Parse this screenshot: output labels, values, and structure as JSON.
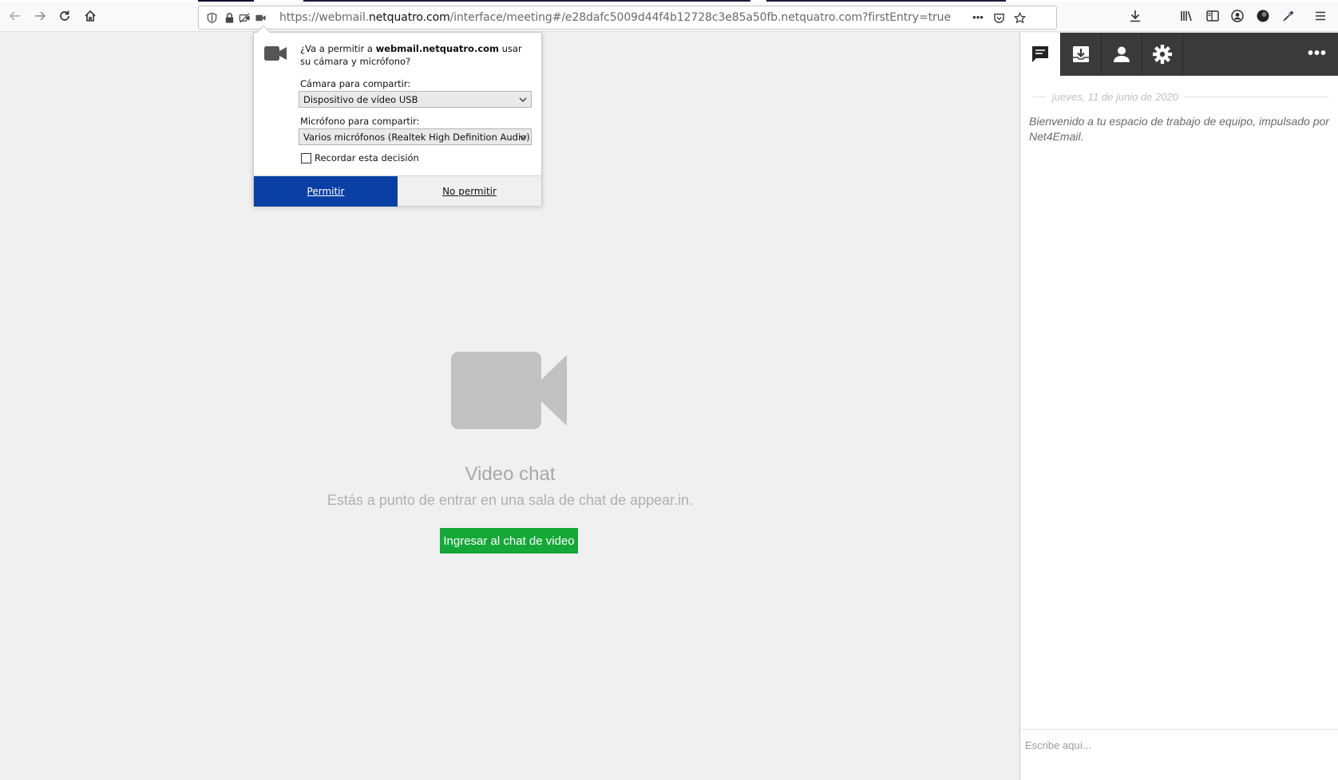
{
  "browser": {
    "url_prefix": "https://webmail.",
    "url_host": "netquatro.com",
    "url_rest": "/interface/meeting#/e28dafc5009d44f4b12728c3e85a50fb.netquatro.com?firstEntry=true",
    "page_actions_label": "•••"
  },
  "permission_popup": {
    "question_prefix": "¿Va a permitir a ",
    "question_host": "webmail.netquatro.com",
    "question_suffix": " usar su cámara y micrófono?",
    "camera_label": "Cámara para compartir:",
    "camera_value": "Dispositivo de vídeo USB",
    "mic_label": "Micrófono para compartir:",
    "mic_value": "Varios micrófonos (Realtek High Definition Audio)",
    "remember_label": "Recordar esta decisión",
    "remember_checked": false,
    "allow_label": "Permitir",
    "deny_label": "No permitir",
    "allow_color": "#0a3fa6"
  },
  "video_chat": {
    "title": "Video chat",
    "subtitle": "Estás a punto de entrar en una sala de chat de appear.in.",
    "join_label": "Ingresar al chat de video",
    "join_color": "#15a838"
  },
  "right_panel": {
    "tabs": [
      {
        "icon": "chat-icon",
        "active": true
      },
      {
        "icon": "inbox-download-icon",
        "active": false
      },
      {
        "icon": "user-icon",
        "active": false
      },
      {
        "icon": "gear-icon",
        "active": false
      }
    ],
    "more_label": "•••",
    "date": "jueves, 11 de junio de 2020",
    "welcome": "Bienvenido a tu espacio de trabajo de equipo, impulsado por Net4Email.",
    "input_placeholder": "Escribe aquí..."
  }
}
